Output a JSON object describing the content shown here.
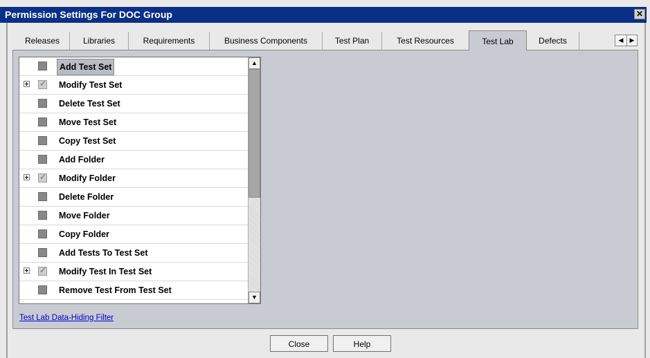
{
  "window": {
    "title": "Permission Settings For DOC Group",
    "close_glyph": "✕"
  },
  "tabs": [
    {
      "label": "Releases",
      "active": false
    },
    {
      "label": "Libraries",
      "active": false
    },
    {
      "label": "Requirements",
      "active": false
    },
    {
      "label": "Business Components",
      "active": false
    },
    {
      "label": "Test Plan",
      "active": false
    },
    {
      "label": "Test Resources",
      "active": false
    },
    {
      "label": "Test Lab",
      "active": true
    },
    {
      "label": "Defects",
      "active": false
    }
  ],
  "tab_scroll": {
    "left_icon": "triangle-left-icon",
    "right_icon": "triangle-right-icon",
    "left_glyph": "◀",
    "right_glyph": "▶"
  },
  "permissions": [
    {
      "label": "Add Test Set",
      "expandable": false,
      "checked": false,
      "selected": true
    },
    {
      "label": "Modify Test Set",
      "expandable": true,
      "checked": true,
      "selected": false
    },
    {
      "label": "Delete Test Set",
      "expandable": false,
      "checked": false,
      "selected": false
    },
    {
      "label": "Move Test Set",
      "expandable": false,
      "checked": false,
      "selected": false
    },
    {
      "label": "Copy Test Set",
      "expandable": false,
      "checked": false,
      "selected": false
    },
    {
      "label": "Add Folder",
      "expandable": false,
      "checked": false,
      "selected": false
    },
    {
      "label": "Modify Folder",
      "expandable": true,
      "checked": true,
      "selected": false
    },
    {
      "label": "Delete Folder",
      "expandable": false,
      "checked": false,
      "selected": false
    },
    {
      "label": "Move Folder",
      "expandable": false,
      "checked": false,
      "selected": false
    },
    {
      "label": "Copy Folder",
      "expandable": false,
      "checked": false,
      "selected": false
    },
    {
      "label": "Add Tests To Test Set",
      "expandable": false,
      "checked": false,
      "selected": false
    },
    {
      "label": "Modify Test In Test Set",
      "expandable": true,
      "checked": true,
      "selected": false
    },
    {
      "label": "Remove Test From Test Set",
      "expandable": false,
      "checked": false,
      "selected": false
    }
  ],
  "scrollbar": {
    "up_glyph": "▲",
    "down_glyph": "▼"
  },
  "filter_link": "Test Lab Data-Hiding Filter",
  "buttons": {
    "close": "Close",
    "help": "Help"
  }
}
